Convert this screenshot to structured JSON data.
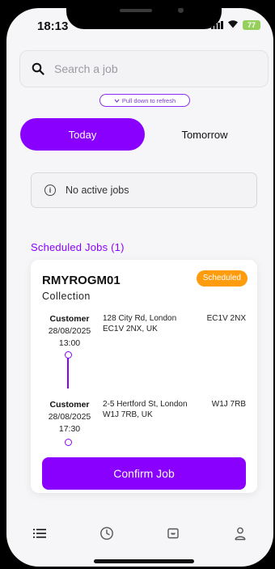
{
  "status_bar": {
    "time": "18:13",
    "battery": "77"
  },
  "search": {
    "placeholder": "Search a job"
  },
  "refresh_hint": {
    "label": "Pull down to refresh"
  },
  "tabs": [
    {
      "label": "Today",
      "active": true
    },
    {
      "label": "Tomorrow",
      "active": false
    }
  ],
  "notice": {
    "text": "No active jobs"
  },
  "scheduled": {
    "title": "Scheduled Jobs (1)",
    "job": {
      "code": "RMYROGM01",
      "type": "Collection",
      "status": "Scheduled",
      "stops": [
        {
          "role": "Customer",
          "date": "28/08/2025",
          "time": "13:00",
          "address": "128 City Rd, London EC1V 2NX, UK",
          "postcode": "EC1V 2NX"
        },
        {
          "role": "Customer",
          "date": "28/08/2025",
          "time": "17:30",
          "address": "2-5 Hertford St, London W1J 7RB, UK",
          "postcode": "W1J 7RB"
        }
      ],
      "action_label": "Confirm Job"
    }
  },
  "bottom_nav": [
    "list-icon",
    "clock-icon",
    "inbox-icon",
    "profile-icon"
  ],
  "colors": {
    "accent": "#8a00ff",
    "badge": "#ff9c0d",
    "battery": "#94d05b"
  }
}
